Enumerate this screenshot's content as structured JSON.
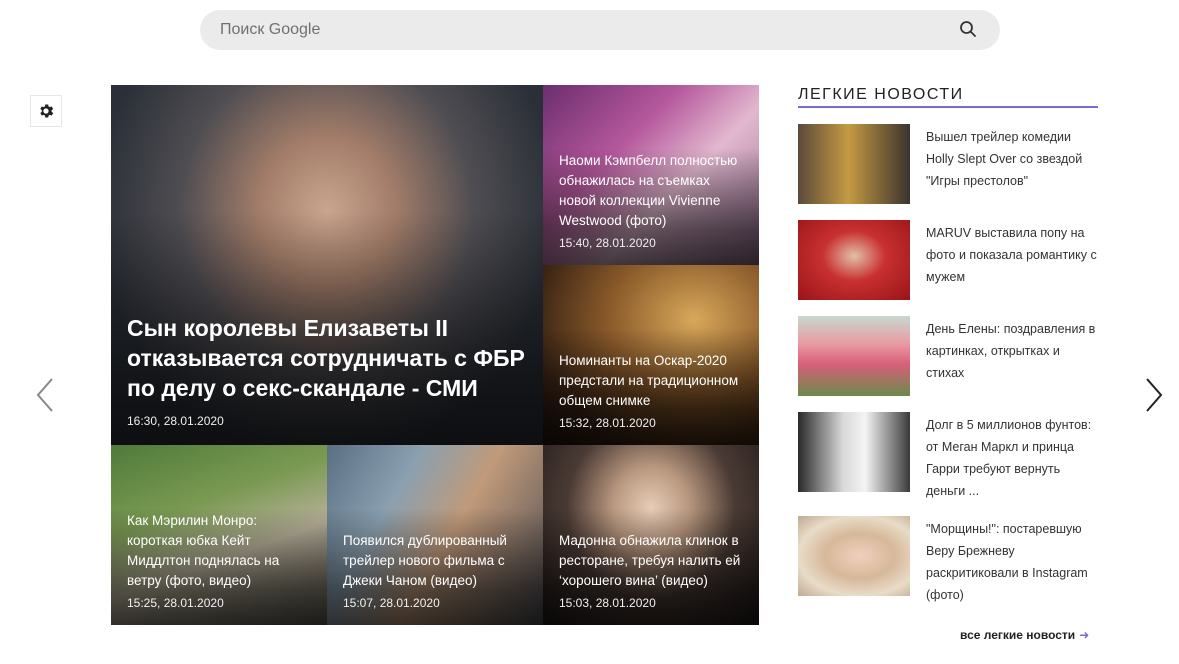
{
  "search": {
    "placeholder": "Поиск Google"
  },
  "icons": {
    "search": "search-icon",
    "settings": "gear-icon",
    "prev": "chevron-left-icon",
    "next": "chevron-right-icon"
  },
  "colors": {
    "accent": "#7c6bd0"
  },
  "main_story": {
    "title": "Сын королевы Елизаветы II отказывается сотрудничать с ФБР по делу о секс-скандале - СМИ",
    "time": "16:30, 28.01.2020"
  },
  "side_stories": [
    {
      "title": "Наоми Кэмпбелл полностью обнажилась на съемках новой коллекции Vivienne Westwood (фото)",
      "time": "15:40, 28.01.2020"
    },
    {
      "title": "Номинанты на Оскар-2020 предстали на традиционном общем снимке",
      "time": "15:32, 28.01.2020"
    }
  ],
  "bottom_stories": [
    {
      "title": "Как Мэрилин Монро: короткая юбка Кейт Миддлтон поднялась на ветру (фото, видео)",
      "time": "15:25, 28.01.2020"
    },
    {
      "title": "Появился дублированный трейлер нового фильма с Джеки Чаном (видео)",
      "time": "15:07, 28.01.2020"
    },
    {
      "title": "Мадонна обнажила клинок в ресторане, требуя налить ей ‘хорошего вина’ (видео)",
      "time": "15:03, 28.01.2020"
    }
  ],
  "light_news": {
    "header": "ЛЕГКИЕ НОВОСТИ",
    "items": [
      {
        "title": "Вышел трейлер комедии Holly Slept Over со звездой \"Игры престолов\""
      },
      {
        "title": "MARUV выставила попу на фото и показала романтику с мужем"
      },
      {
        "title": "День Елены: поздравления в картинках, открытках и стихах"
      },
      {
        "title": "Долг в 5 миллионов фунтов: от Меган Маркл и принца Гарри требуют вернуть деньги ..."
      },
      {
        "title": "\"Морщины!\": постаревшую Веру Брежневу раскритиковали в Instagram (фото)"
      }
    ],
    "all_link": "все легкие новости"
  }
}
